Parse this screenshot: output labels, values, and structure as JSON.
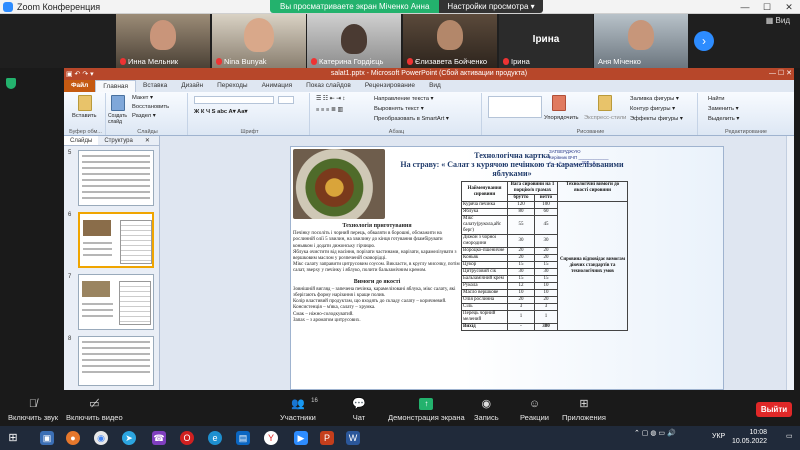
{
  "zoom": {
    "window_title": "Zoom Конференция",
    "view_mode": "Вид",
    "share_banner": {
      "viewing_text": "Вы просматриваете экран Міченко Анна",
      "view_options": "Настройки просмотра ▾"
    },
    "participants": [
      {
        "name": "Инна Мельник",
        "muted": true
      },
      {
        "name": "Nina Bunyak",
        "muted": true
      },
      {
        "name": "Катерина Гордієць",
        "muted": true
      },
      {
        "name": "Єлизавета Бойченко",
        "muted": true
      },
      {
        "name": "Ірина",
        "muted": true,
        "big": "Ірина"
      },
      {
        "name": "Аня Міченко",
        "muted": false
      }
    ],
    "toolbar": {
      "unmute": "Включить звук",
      "video": "Включить видео",
      "participants": "Участники",
      "participants_count": "16",
      "chat": "Чат",
      "share": "Демонстрация экрана",
      "record": "Запись",
      "reactions": "Реакции",
      "apps": "Приложения",
      "leave": "Выйти"
    }
  },
  "powerpoint": {
    "title": "salat1.pptx - Microsoft PowerPoint (Сбой активации продукта)",
    "tabs": [
      "Файл",
      "Главная",
      "Вставка",
      "Дизайн",
      "Переходы",
      "Анимация",
      "Показ слайдов",
      "Рецензирование",
      "Вид"
    ],
    "ribbon": {
      "clipboard": {
        "paste": "Вставить",
        "label": "Буфер обм..."
      },
      "slides": {
        "new": "Создать слайд",
        "layout": "Макет ▾",
        "reset": "Восстановить",
        "section": "Раздел ▾",
        "label": "Слайды"
      },
      "font": {
        "label": "Шрифт"
      },
      "paragraph": {
        "direction": "Направление текста ▾",
        "align": "Выровнять текст ▾",
        "smartart": "Преобразовать в SmartArt ▾",
        "label": "Абзац"
      },
      "drawing": {
        "arrange": "Упорядочить",
        "styles": "Экспресс-стили",
        "fill": "Заливка фигуры ▾",
        "outline": "Контур фигуры ▾",
        "effects": "Эффекты фигуры ▾",
        "label": "Рисование"
      },
      "editing": {
        "find": "Найти",
        "replace": "Заменить ▾",
        "select": "Выделить ▾",
        "label": "Редактирование"
      }
    },
    "panel_tabs": [
      "Слайды",
      "Структура"
    ],
    "slide_numbers": [
      "5",
      "6",
      "7",
      "8"
    ],
    "slide": {
      "title_line1": "Технологічна  картка",
      "title_line2": "На страву: « Салат з курячою печінкою та карамелізованими яблуками»",
      "stamp": "ЗАТВЕРДЖУЮ\nКерівник  ВЧП ____________\n«___» _______ 202_ р",
      "tech_heading": "Технологія  приготування",
      "tech_text": [
        "Печінку посоліть і чорний перець, обваляти в борошні, обсмажити на рослинній олії 5 хвилин, на хвилину до кінця готування фламбірувати коньяком і додати дижонську гірчицю.",
        "Яблука очистити від насіння, порізати частинами, нарізати, карамелізувати з вершковим маслом у розпеченій сковорідці.",
        "Мікс салату заправити цитрусовим соусом. Викласти, в круглу мисочку, потім салат, зверху у печінку і яблуко, полити бальзамічним кремом."
      ],
      "quality_heading": "Вимоги до якості",
      "quality_text": [
        "Зовнішній вигляд – запечена печінка, карамелізовані яблука, мікс салату, які зберігають форму нарізання і краще полив.",
        "Колір властивий продуктам, що входять до складу салату – коричневий.",
        "Консистенція – м'яка, салату – хрумка.",
        "Смак – ніжно-солодкуватий.",
        "Запах – з ароматом цитрусових."
      ],
      "table": {
        "headers": [
          "Найменування сировини",
          "Вага сировини на 1 порцію/в грамах",
          "Технологічні вимоги до якості сировини"
        ],
        "subheaders": [
          "брутто",
          "нетто"
        ],
        "rows": [
          [
            "Куряча печінка",
            "120",
            "100"
          ],
          [
            "Яблука",
            "80",
            "60"
          ],
          [
            "Мікс салату(рукола,айс берг)",
            "55",
            "45"
          ],
          [
            "Дижон з чорної смородини",
            "30",
            "30"
          ],
          [
            "Вороцко-пшеничне",
            "20",
            "20"
          ],
          [
            "Коньяк",
            "20",
            "20"
          ],
          [
            "Цукор",
            "15",
            "15"
          ],
          [
            "Цитрусовий сік",
            "30",
            "30"
          ],
          [
            "Бальзамічний крем",
            "15",
            "15"
          ],
          [
            "Рукола",
            "12",
            "10"
          ],
          [
            "Масло вершкове",
            "10",
            "10"
          ],
          [
            "Олія рослинна",
            "20",
            "20"
          ],
          [
            "Сіль",
            "3",
            "3"
          ],
          [
            "Перець чорний мелений",
            "1",
            "1"
          ],
          [
            "Вихід",
            "-",
            "380"
          ]
        ],
        "note": "Сировина відповідає вимогам діючих стандартів та технологічних умов"
      }
    }
  },
  "taskbar": {
    "language": "УКР",
    "time": "10:08",
    "date": "10.05.2022"
  },
  "colors": {
    "zoom_green": "#23b26d",
    "leave_red": "#e02828",
    "ppt_red": "#b7472a",
    "zoom_blue": "#2d8cff"
  }
}
